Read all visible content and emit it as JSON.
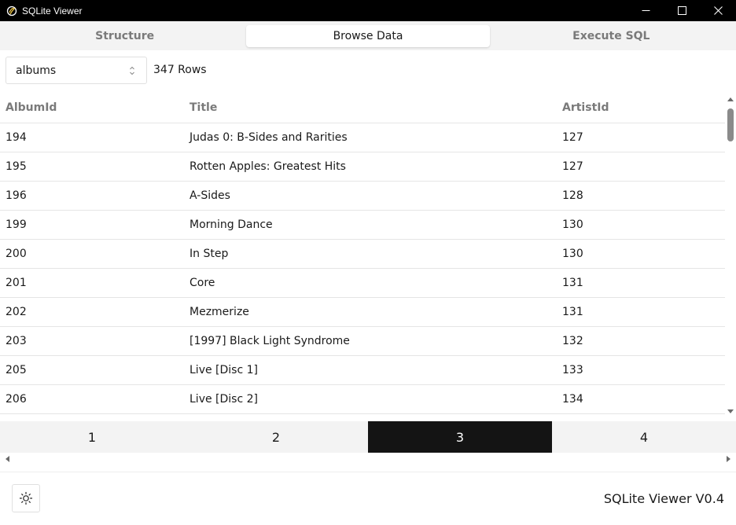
{
  "window": {
    "title": "SQLite Viewer"
  },
  "tabs": [
    {
      "label": "Structure",
      "active": false
    },
    {
      "label": "Browse Data",
      "active": true
    },
    {
      "label": "Execute SQL",
      "active": false
    }
  ],
  "table_select": {
    "value": "albums"
  },
  "row_count": "347 Rows",
  "columns": [
    "AlbumId",
    "Title",
    "ArtistId"
  ],
  "rows": [
    [
      "194",
      "Judas 0: B-Sides and Rarities",
      "127"
    ],
    [
      "195",
      "Rotten Apples: Greatest Hits",
      "127"
    ],
    [
      "196",
      "A-Sides",
      "128"
    ],
    [
      "199",
      "Morning Dance",
      "130"
    ],
    [
      "200",
      "In Step",
      "130"
    ],
    [
      "201",
      "Core",
      "131"
    ],
    [
      "202",
      "Mezmerize",
      "131"
    ],
    [
      "203",
      "[1997] Black Light Syndrome",
      "132"
    ],
    [
      "205",
      "Live [Disc 1]",
      "133"
    ],
    [
      "206",
      "Live [Disc 2]",
      "134"
    ]
  ],
  "pagination": {
    "pages": [
      "1",
      "2",
      "3",
      "4"
    ],
    "active": "3"
  },
  "footer": {
    "theme_icon": "sun-icon",
    "version": "SQLite Viewer V0.4"
  },
  "colors": {
    "titlebar_bg": "#000000",
    "active_page_bg": "#141414",
    "muted_text": "#7a7a7a",
    "tab_bar_bg": "#f3f3f3"
  }
}
